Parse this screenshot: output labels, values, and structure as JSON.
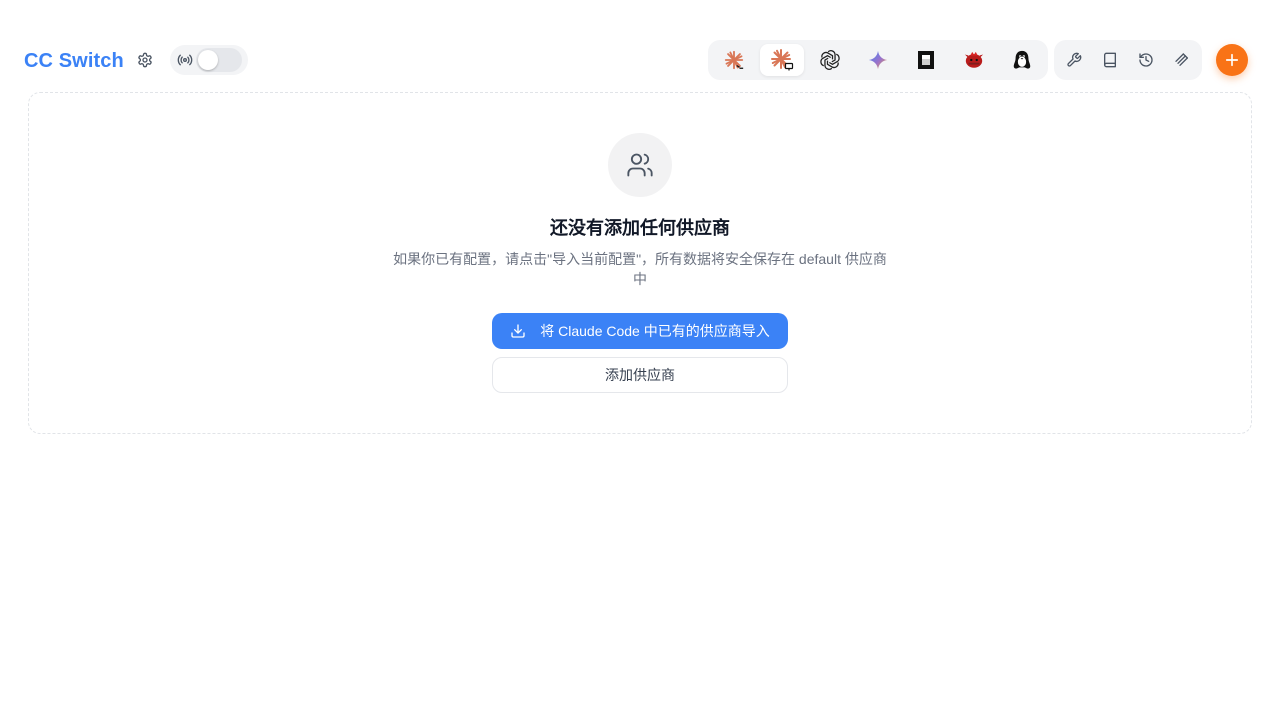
{
  "header": {
    "title": "CC Switch",
    "settings_icon": "gear-icon",
    "proxy": {
      "icon": "broadcast-icon",
      "enabled": false
    }
  },
  "app_switcher": {
    "apps": [
      {
        "name": "claude-icon",
        "active": false
      },
      {
        "name": "claude-desktop-icon",
        "active": true
      },
      {
        "name": "openai-icon",
        "active": false
      },
      {
        "name": "gemini-icon",
        "active": false
      },
      {
        "name": "opencode-icon",
        "active": false
      },
      {
        "name": "red-bird-icon",
        "active": false
      },
      {
        "name": "penguin-icon",
        "active": false
      }
    ]
  },
  "tools": [
    "wrench-icon",
    "book-icon",
    "history-icon",
    "skills-icon"
  ],
  "add_button_icon": "plus-icon",
  "empty_state": {
    "icon": "users-icon",
    "title": "还没有添加任何供应商",
    "description": "如果你已有配置，请点击\"导入当前配置\"，所有数据将安全保存在 default 供应商中",
    "import_label": "将 Claude Code 中已有的供应商导入",
    "add_label": "添加供应商"
  },
  "colors": {
    "accent": "#3b82f6",
    "fab": "#f97316",
    "claude": "#d97757"
  }
}
